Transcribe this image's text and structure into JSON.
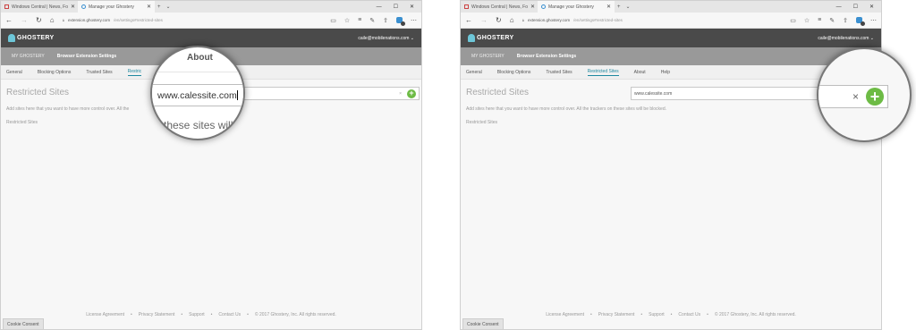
{
  "browser": {
    "tab1": "Windows Central | News, Fo",
    "tab2": "Manage your Ghostery",
    "url_host": "extension.ghostery.com",
    "url_path": "/en/settings#restricted-sites"
  },
  "ghostery": {
    "logo": "GHOSTERY",
    "user": "caile@mobilenations.com",
    "nav": [
      "MY GHOSTERY",
      "Browser Extension Settings"
    ],
    "tabs": [
      "General",
      "Blocking Options",
      "Trusted Sites",
      "Restricted Sites",
      "About",
      "Help"
    ],
    "left_tab_partial": "Restric"
  },
  "content": {
    "title": "Restricted Sites",
    "desc_left": "Add sites here that you want to have more control over. All the",
    "desc_right": "Add sites here that you want to have more control over. All the trackers on these sites will be blocked.",
    "list_label": "Restricted Sites",
    "input_value": "www.calessite.com"
  },
  "magnifier": {
    "about": "About",
    "input_text": "www.calessite.com",
    "partial_text": "these sites will be"
  },
  "footer": {
    "links": [
      "License Agreement",
      "Privacy Statement",
      "Support",
      "Contact Us"
    ],
    "copyright": "© 2017 Ghostery, Inc. All rights reserved."
  },
  "cookie": "Cookie Consent"
}
